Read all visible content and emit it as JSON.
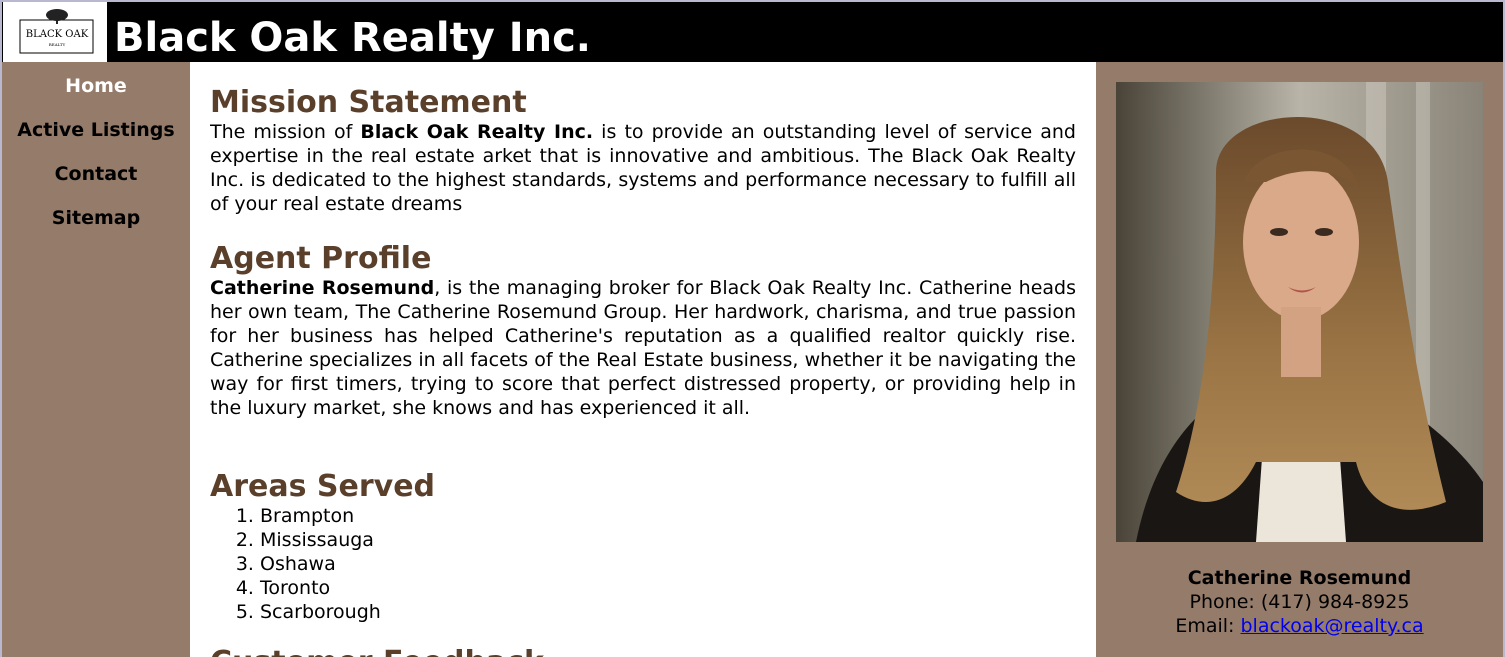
{
  "header": {
    "logo_text": "BLACK OAK",
    "logo_subtext": "REALTY",
    "title": "Black Oak Realty Inc."
  },
  "nav": {
    "items": [
      {
        "label": "Home",
        "active": true
      },
      {
        "label": "Active Listings",
        "active": false
      },
      {
        "label": "Contact",
        "active": false
      },
      {
        "label": "Sitemap",
        "active": false
      }
    ]
  },
  "main": {
    "mission": {
      "heading": "Mission Statement",
      "text_before": "The mission of ",
      "bold": "Black Oak Realty Inc.",
      "text_after": " is to provide an outstanding level of service and expertise in the real estate arket that is innovative and ambitious. The Black Oak Realty Inc. is dedicated to the highest standards, systems and performance necessary to fulfill all of your real estate dreams"
    },
    "profile": {
      "heading": "Agent Profile",
      "bold": "Catherine Rosemund",
      "text_after": ", is the managing broker for Black Oak Realty Inc. Catherine heads her own team, The Catherine Rosemund Group. Her hardwork, charisma, and true passion for her business has helped Catherine's reputation as a qualified realtor quickly rise. Catherine specializes in all facets of the Real Estate business, whether it be navigating the way for first timers, trying to score that perfect distressed property, or providing help in the luxury market, she knows and has experienced it all."
    },
    "areas": {
      "heading": "Areas Served",
      "items": [
        "Brampton",
        "Mississauga",
        "Oshawa",
        "Toronto",
        "Scarborough"
      ]
    },
    "feedback": {
      "heading": "Customer Feedback"
    }
  },
  "agent": {
    "name": "Catherine Rosemund",
    "phone": "Phone: (417) 984-8925",
    "email_label": "Email: ",
    "email": "blackoak@realty.ca"
  },
  "colors": {
    "header_bg": "#000000",
    "sidebar_bg": "#957b6a",
    "heading": "#5a3f2b",
    "link": "#0000ee"
  }
}
